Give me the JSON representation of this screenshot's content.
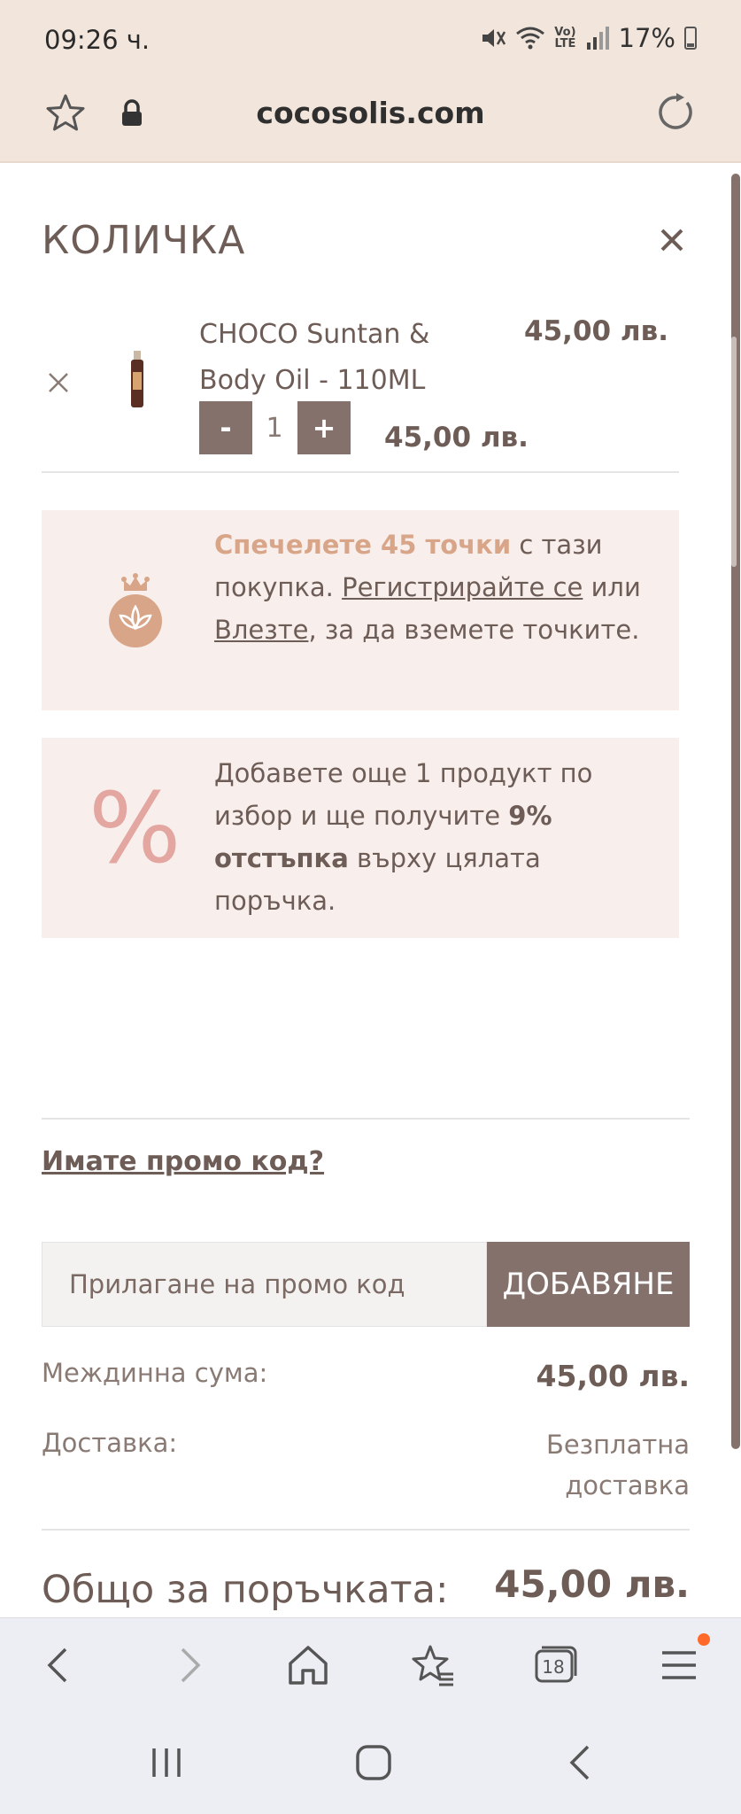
{
  "status_bar": {
    "time": "09:26 ч.",
    "battery": "17%",
    "icons": [
      "mute-icon",
      "wifi-icon",
      "volte-icon",
      "signal-icon",
      "battery-icon"
    ]
  },
  "url_bar": {
    "domain": "cocosolis.com",
    "icons": [
      "star-icon",
      "lock-icon",
      "reload-icon"
    ]
  },
  "cart": {
    "title": "КОЛИЧКА",
    "close_icon": "close-icon",
    "item": {
      "name": "CHOCO Suntan & Body Oil - 110ML",
      "price": "45,00 лв.",
      "quantity": "1",
      "minus_label": "-",
      "plus_label": "+",
      "line_total": "45,00 лв."
    },
    "points_box": {
      "icon": "lotus-crown-icon",
      "highlight": "Спечелете 45 точки",
      "text_after_highlight": " с тази покупка. ",
      "register_link": "Регистрирайте се",
      "middle_text": " или ",
      "login_link": "Влезте",
      "end_text": ", за да вземете точките."
    },
    "discount_box": {
      "icon_glyph": "%",
      "text_start": "Добавете още 1 продукт по избор и ще получите ",
      "bold_text": "9% отстъпка",
      "text_end": " върху цялата поръчка."
    },
    "promo": {
      "question": "Имате промо код?",
      "placeholder": "Прилагане на промо код",
      "value": "",
      "button_label": "ДОБАВЯНЕ"
    },
    "totals": {
      "subtotal_label": "Междинна сума:",
      "subtotal_value": "45,00 лв.",
      "shipping_label": "Доставка:",
      "shipping_value": "Безплатна доставка",
      "total_label": "Общо за поръчката:",
      "total_value": "45,00 лв."
    }
  },
  "browser_toolbar": {
    "tabs_count": "18",
    "icons": [
      "back-icon",
      "forward-icon",
      "home-icon",
      "bookmarks-icon",
      "tabs-icon",
      "menu-icon"
    ]
  },
  "system_nav": {
    "icons": [
      "recents-icon",
      "home-button-icon",
      "system-back-icon"
    ]
  },
  "colors": {
    "brand_brown": "#85716b",
    "text_brown": "#6e5c56",
    "promo_bg": "#f8efec",
    "highlight": "#d8a588",
    "topbar_bg": "#f2e5db"
  }
}
